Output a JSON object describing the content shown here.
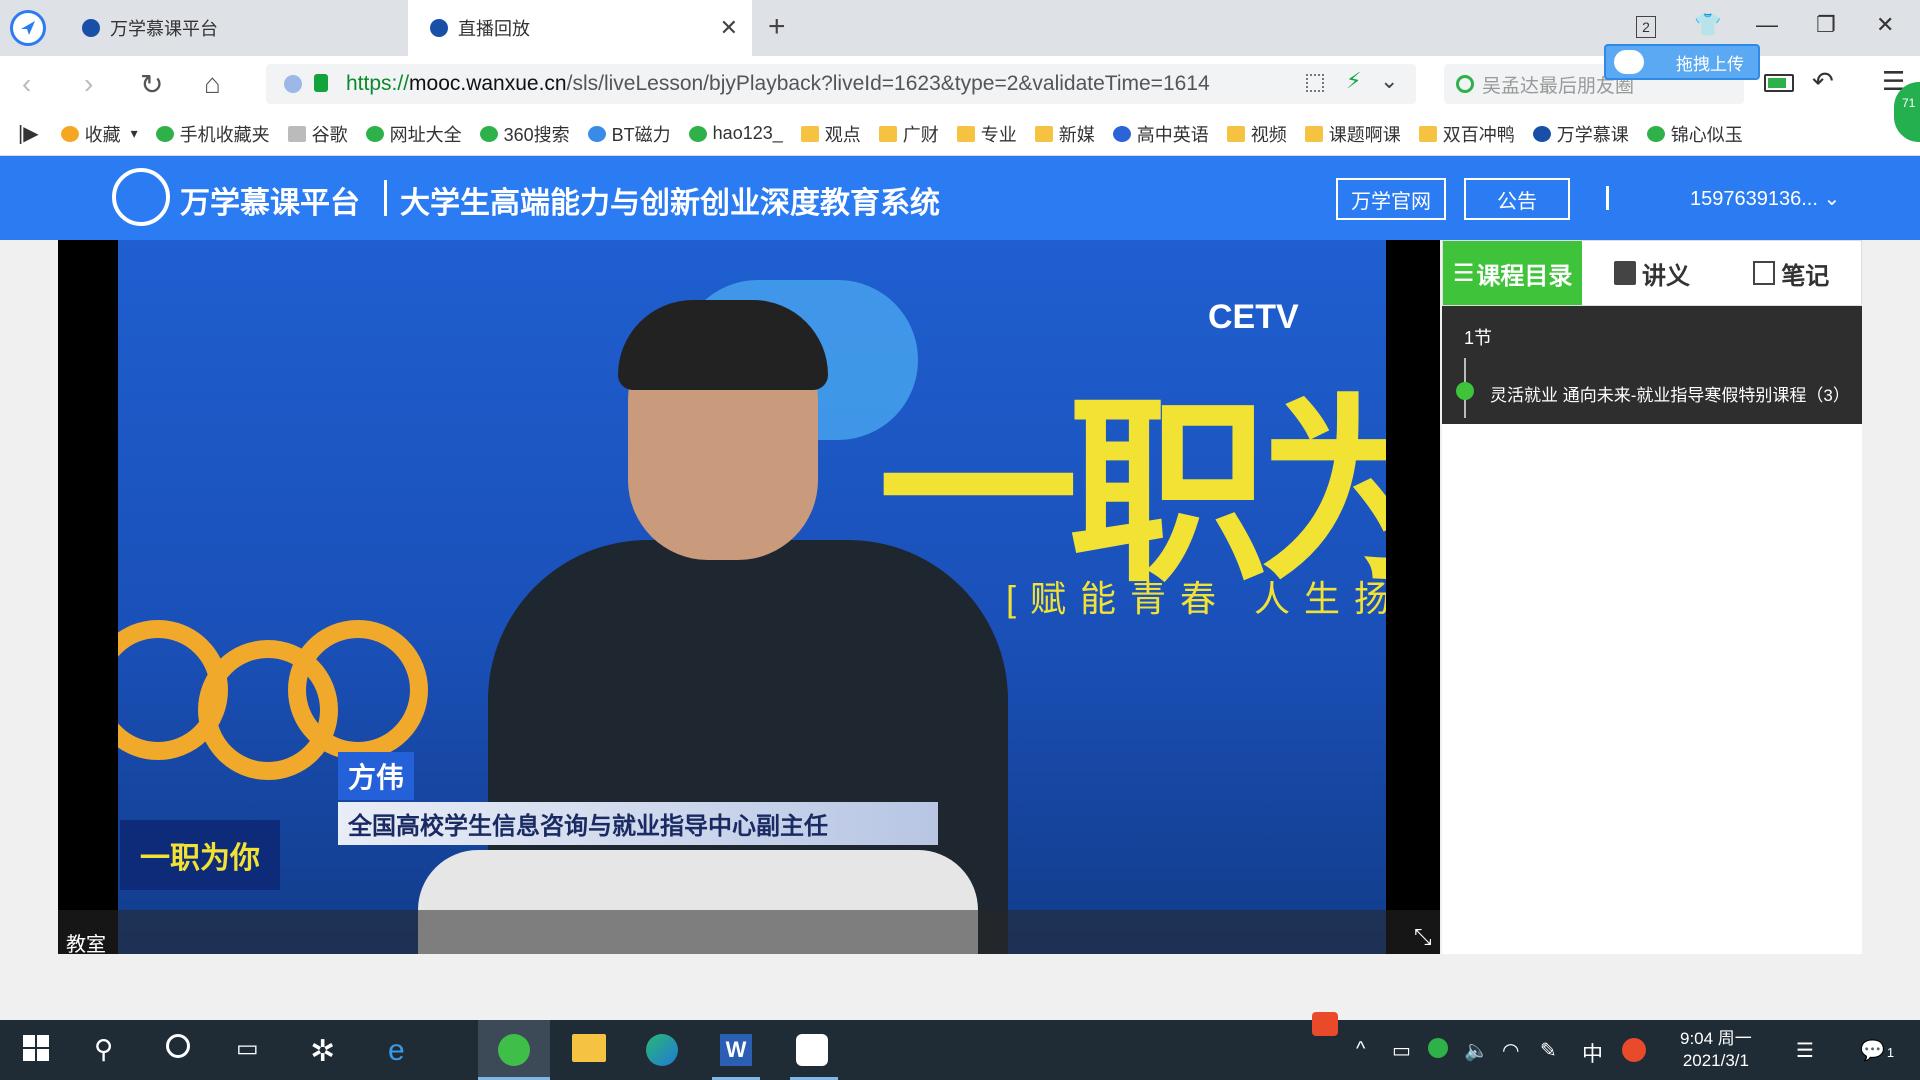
{
  "browser": {
    "tabs": [
      {
        "title": "万学慕课平台",
        "active": false
      },
      {
        "title": "直播回放",
        "active": true
      }
    ],
    "tab_counter": "2",
    "url": {
      "scheme": "https://",
      "host": "mooc.wanxue.cn",
      "path": "/sls/liveLesson/bjyPlayback?liveId=1623&type=2&validateTime=1614"
    },
    "search_placeholder": "吴孟达最后朋友圈",
    "upload_label": "拖拽上传",
    "side_badge": "71"
  },
  "bookmarks": [
    {
      "label": "收藏",
      "icon": "star-icon"
    },
    {
      "label": "手机收藏夹",
      "icon": "phone-icon"
    },
    {
      "label": "谷歌",
      "icon": "page-icon"
    },
    {
      "label": "网址大全",
      "icon": "plus-circle-icon"
    },
    {
      "label": "360搜索",
      "icon": "search-360-icon"
    },
    {
      "label": "BT磁力",
      "icon": "bt-icon"
    },
    {
      "label": "hao123_",
      "icon": "hao-icon"
    },
    {
      "label": "观点",
      "icon": "folder-icon"
    },
    {
      "label": "广财",
      "icon": "folder-icon"
    },
    {
      "label": "专业",
      "icon": "folder-icon"
    },
    {
      "label": "新媒",
      "icon": "folder-icon"
    },
    {
      "label": "高中英语",
      "icon": "paw-icon"
    },
    {
      "label": "视频",
      "icon": "folder-icon"
    },
    {
      "label": "课题啊课",
      "icon": "folder-icon"
    },
    {
      "label": "双百冲鸭",
      "icon": "folder-icon"
    },
    {
      "label": "万学慕课",
      "icon": "wanxue-icon"
    },
    {
      "label": "锦心似玉",
      "icon": "play-icon"
    }
  ],
  "site": {
    "brand": "万学慕课平台",
    "subtitle": "大学生高端能力与创新创业深度教育系统",
    "official_site_label": "万学官网",
    "notice_label": "公告",
    "user_id": "1597639136...",
    "accent": "#2b7cf3"
  },
  "video": {
    "channel": "CETV",
    "show_title": "一职为你",
    "slogan": "[赋能青春 人生扬帆]",
    "speaker_name": "方伟",
    "speaker_role": "全国高校学生信息咨询与就业指导中心副主任",
    "room_label": "教室"
  },
  "sidebar": {
    "tabs": [
      {
        "label": "课程目录",
        "icon": "list-icon",
        "active": true
      },
      {
        "label": "讲义",
        "icon": "document-icon",
        "active": false
      },
      {
        "label": "笔记",
        "icon": "edit-icon",
        "active": false
      }
    ],
    "chapter": "1节",
    "lesson": "灵活就业 通向未来-就业指导寒假特别课程（3）",
    "active_color": "#3fc33a"
  },
  "taskbar": {
    "time": "9:04 周一",
    "date": "2021/3/1",
    "ime": "中",
    "notification_count": "1"
  }
}
